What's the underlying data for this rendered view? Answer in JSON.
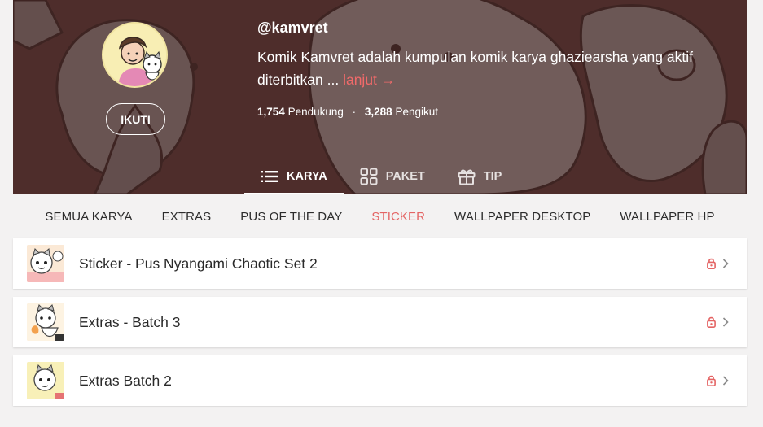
{
  "creator": {
    "username": "@kamvret",
    "bio": "Komik Kamvret adalah kumpulan komik karya ghaziearsha yang aktif diterbitkan ...",
    "bio_more": "lanjut →",
    "follow_label": "IKUTI",
    "supporters_count": "1,754",
    "supporters_label": "Pendukung",
    "followers_count": "3,288",
    "followers_label": "Pengikut",
    "separator": "·"
  },
  "tabs": [
    {
      "label": "KARYA",
      "icon": "list-icon",
      "active": true
    },
    {
      "label": "PAKET",
      "icon": "grid-icon",
      "active": false
    },
    {
      "label": "TIP",
      "icon": "gift-icon",
      "active": false
    }
  ],
  "categories": [
    {
      "label": "SEMUA KARYA",
      "active": false
    },
    {
      "label": "EXTRAS",
      "active": false
    },
    {
      "label": "PUS OF THE DAY",
      "active": false
    },
    {
      "label": "STICKER",
      "active": true
    },
    {
      "label": "WALLPAPER DESKTOP",
      "active": false
    },
    {
      "label": "WALLPAPER HP",
      "active": false
    }
  ],
  "items": [
    {
      "title": "Sticker - Pus Nyangami Chaotic Set 2",
      "lock_icon": "lock-icon",
      "arrow_icon": "chevron-right-icon"
    },
    {
      "title": "Extras - Batch 3",
      "lock_icon": "lock-icon",
      "arrow_icon": "chevron-right-icon"
    },
    {
      "title": "Extras Batch 2",
      "lock_icon": "lock-icon",
      "arrow_icon": "chevron-right-icon"
    }
  ],
  "colors": {
    "banner_bg": "#4e2e2b",
    "accent": "#e46464",
    "page_bg": "#f3f2f2"
  }
}
